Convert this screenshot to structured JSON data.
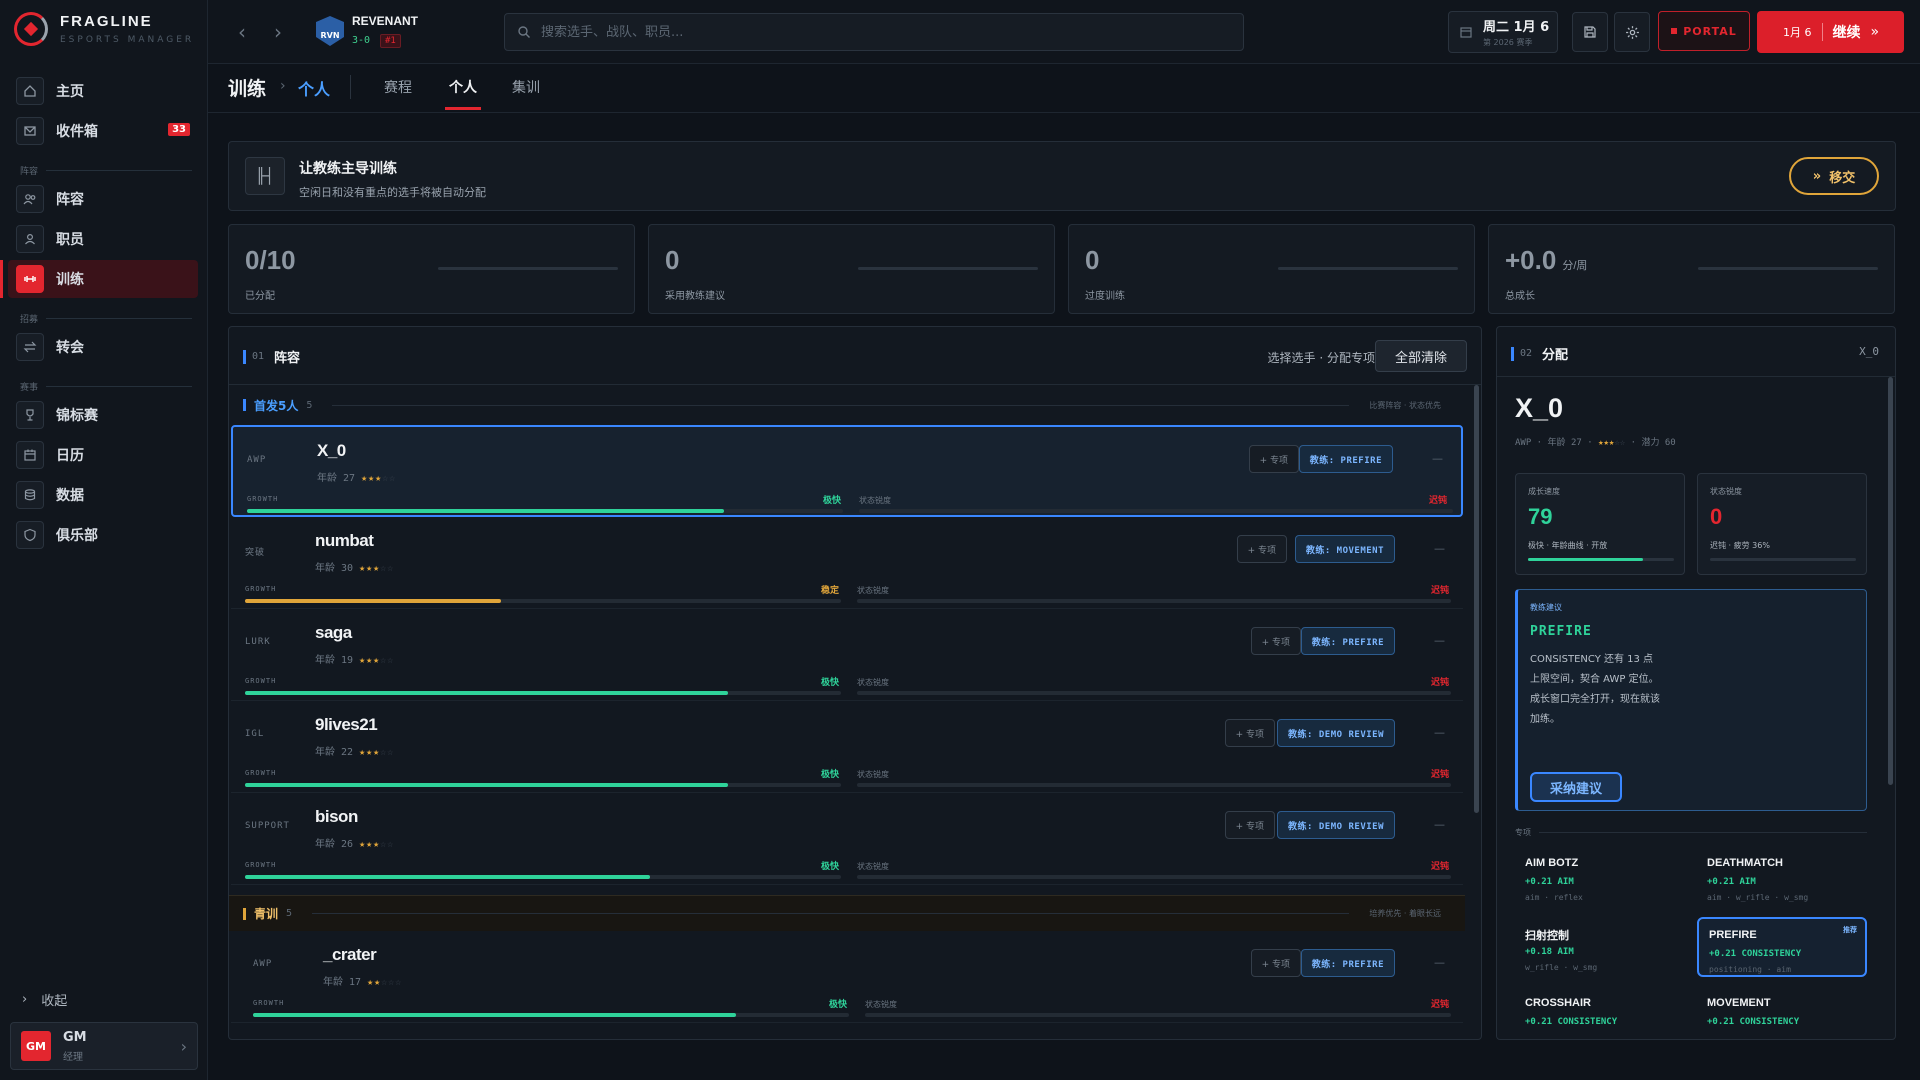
{
  "app": {
    "name": "FRAGLINE",
    "subtitle": "ESPORTS MANAGER"
  },
  "colors": {
    "accent": "#e3262f",
    "primary": "#3a87ff",
    "green": "#2fd39a",
    "yellow": "#e0a53a",
    "bg": "#0e131a"
  },
  "sidebar": {
    "items": [
      {
        "label": "主页",
        "icon": "home-icon"
      },
      {
        "label": "收件箱",
        "icon": "mail-icon",
        "badge": "33"
      },
      {
        "label": "阵容",
        "icon": "users-icon"
      },
      {
        "label": "职员",
        "icon": "user-icon"
      },
      {
        "label": "训练",
        "icon": "dumbbell-icon",
        "active": true
      },
      {
        "label": "转会",
        "icon": "transfer-icon"
      },
      {
        "label": "锦标赛",
        "icon": "trophy-icon"
      },
      {
        "label": "日历",
        "icon": "calendar-icon"
      },
      {
        "label": "数据",
        "icon": "database-icon"
      },
      {
        "label": "俱乐部",
        "icon": "shield-icon"
      }
    ],
    "sections": [
      "阵容",
      "招募",
      "赛事"
    ],
    "collapse_label": "收起",
    "user": {
      "avatar": "GM",
      "name": "GM",
      "role": "经理"
    }
  },
  "topbar": {
    "team": {
      "logo": "RVN",
      "name": "REVENANT",
      "record": "3-0",
      "rank": "#1"
    },
    "search_placeholder": "搜索选手、战队、职员...",
    "date": {
      "day": "周二  1月 6",
      "season": "第 2026 赛季"
    },
    "portal_label": "PORTAL",
    "continue": {
      "date": "1月 6",
      "label": "继续"
    }
  },
  "page": {
    "section": "训练",
    "current": "个人",
    "tabs": [
      "赛程",
      "个人",
      "集训"
    ],
    "active_tab": 1
  },
  "banner": {
    "title": "让教练主导训练",
    "subtitle": "空闲日和没有重点的选手将被自动分配",
    "button": "移交"
  },
  "stats": [
    {
      "value": "0/10",
      "unit": "",
      "label": "已分配"
    },
    {
      "value": "0",
      "unit": "",
      "label": "采用教练建议"
    },
    {
      "value": "0",
      "unit": "",
      "label": "过度训练"
    },
    {
      "value": "+0.0",
      "unit": "分/周",
      "label": "总成长"
    }
  ],
  "roster": {
    "num": "01",
    "title": "阵容",
    "hint": "选择选手 · 分配专项",
    "clear_all": "全部清除",
    "starters": {
      "title": "首发5人",
      "count": "5",
      "note": "比赛阵容  ·  状态优先"
    },
    "youth": {
      "title": "青训",
      "count": "5",
      "note": "培养优先  ·  着眼长远"
    },
    "spec_label": "+ 专项",
    "growth_label": "GROWTH",
    "state_label": "状态锐度",
    "players": [
      {
        "role": "AWP",
        "name": "X_0",
        "age": "年龄 27",
        "stars_on": "★★★",
        "stars_off": "☆☆",
        "coach": "教练: PREFIRE",
        "growth": 0.8,
        "growth_text": "极快",
        "growth_color": "#2fd39a",
        "state_text": "迟钝",
        "state_fill": 0,
        "dash": "—",
        "selected": true
      },
      {
        "role": "突破",
        "name": "numbat",
        "age": "年龄 30",
        "stars_on": "★★★",
        "stars_off": "☆☆",
        "coach": "教练: MOVEMENT",
        "growth": 0.43,
        "growth_text": "稳定",
        "growth_color": "#e0a53a",
        "state_text": "迟钝",
        "state_fill": 0,
        "dash": "—"
      },
      {
        "role": "LURK",
        "name": "saga",
        "age": "年龄 19",
        "stars_on": "★★★",
        "stars_off": "☆☆",
        "coach": "教练: PREFIRE",
        "growth": 0.81,
        "growth_text": "极快",
        "growth_color": "#2fd39a",
        "state_text": "迟钝",
        "state_fill": 0,
        "dash": "—"
      },
      {
        "role": "IGL",
        "name": "9lives21",
        "age": "年龄 22",
        "stars_on": "★★★",
        "stars_off": "☆☆",
        "coach": "教练: DEMO REVIEW",
        "growth": 0.81,
        "growth_text": "极快",
        "growth_color": "#2fd39a",
        "state_text": "迟钝",
        "state_fill": 0,
        "dash": "—"
      },
      {
        "role": "SUPPORT",
        "name": "bison",
        "age": "年龄 26",
        "stars_on": "★★★",
        "stars_off": "☆☆",
        "coach": "教练: DEMO REVIEW",
        "growth": 0.68,
        "growth_text": "极快",
        "growth_color": "#2fd39a",
        "state_text": "迟钝",
        "state_fill": 0,
        "dash": "—"
      },
      {
        "role": "AWP",
        "name": "_crater",
        "age": "年龄 17",
        "stars_on": "★★",
        "stars_off": "☆☆☆",
        "coach": "教练: PREFIRE",
        "growth": 0.81,
        "growth_text": "极快",
        "growth_color": "#2fd39a",
        "state_text": "迟钝",
        "state_fill": 0,
        "dash": "—"
      }
    ]
  },
  "alloc": {
    "num": "02",
    "title": "分配",
    "player": "X_0",
    "name": "X_0",
    "meta_role": "AWP",
    "meta_age": "年龄 27",
    "stars_on": "★★★",
    "stars_off": "☆☆",
    "potential": "潜力 60",
    "growth_card": {
      "label": "成长速度",
      "value": "79",
      "sub": "极快  ·  年龄曲线  ·  开放",
      "fill": 0.79
    },
    "state_card": {
      "label": "状态锐度",
      "value": "0",
      "sub": "迟钝  ·  疲劳 36%",
      "fill": 0
    },
    "advice": {
      "label": "教练建议",
      "title": "PREFIRE",
      "body": "CONSISTENCY 还有 13 点上限空间，契合 AWP 定位。成长窗口完全打开，现在就该加练。",
      "button": "采纳建议"
    },
    "spec_section": "专项",
    "specs": [
      {
        "name": "AIM BOTZ",
        "gain": "+0.21 AIM",
        "keys": "aim · reflex"
      },
      {
        "name": "DEATHMATCH",
        "gain": "+0.21 AIM",
        "keys": "aim · w_rifle · w_smg"
      },
      {
        "name": "扫射控制",
        "gain": "+0.18 AIM",
        "keys": "w_rifle · w_smg"
      },
      {
        "name": "PREFIRE",
        "gain": "+0.21 CONSISTENCY",
        "keys": "positioning · aim",
        "recommended": "推荐"
      },
      {
        "name": "CROSSHAIR",
        "gain": "+0.21 CONSISTENCY",
        "keys": ""
      },
      {
        "name": "MOVEMENT",
        "gain": "+0.21 CONSISTENCY",
        "keys": ""
      }
    ]
  }
}
